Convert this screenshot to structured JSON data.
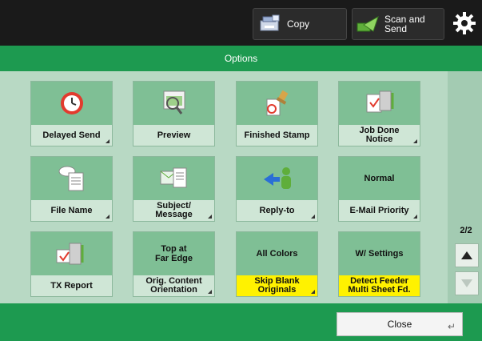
{
  "topbar": {
    "copy_label": "Copy",
    "scan_label": "Scan and\nSend"
  },
  "header": {
    "title": "Options"
  },
  "tiles": [
    {
      "label": "Delayed Send",
      "icon": "clock-icon"
    },
    {
      "label": "Preview",
      "icon": "preview-icon"
    },
    {
      "label": "Finished Stamp",
      "icon": "stamp-icon"
    },
    {
      "label": "Job Done\nNotice",
      "icon": "job-done-icon"
    },
    {
      "label": "File Name",
      "icon": "file-name-icon"
    },
    {
      "label": "Subject/\nMessage",
      "icon": "subject-message-icon"
    },
    {
      "label": "Reply-to",
      "icon": "reply-to-icon"
    },
    {
      "label": "E-Mail Priority",
      "value": "Normal"
    },
    {
      "label": "TX Report",
      "icon": "tx-report-icon"
    },
    {
      "label": "Orig. Content\nOrientation",
      "value": "Top at\nFar Edge"
    },
    {
      "label": "Skip Blank\nOriginals",
      "value": "All Colors",
      "highlight": true
    },
    {
      "label": "Detect Feeder\nMulti Sheet Fd.",
      "value": "W/ Settings",
      "highlight": true
    }
  ],
  "pager": {
    "text": "2/2"
  },
  "footer": {
    "close_label": "Close"
  }
}
